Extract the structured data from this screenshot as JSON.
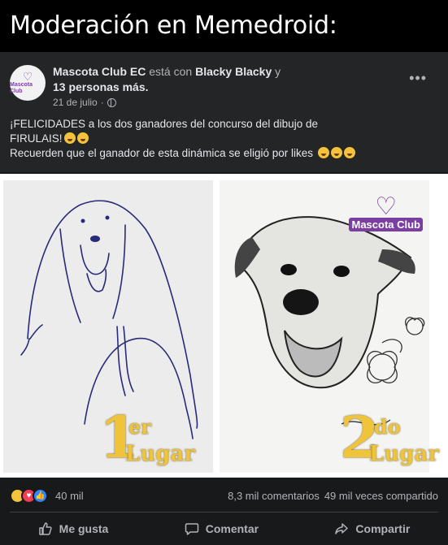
{
  "meme_title": "Moderación en Memedroid:",
  "post": {
    "page_name": "Mascota Club EC",
    "with_text": "está con",
    "tagged": "Blacky Blacky",
    "and_text": "y",
    "others": "13 personas más.",
    "date": "21 de julio",
    "dot": "·",
    "avatar_logo_text": "Mascota Club",
    "more_label": "•••",
    "line1": "¡FELICIDADES a los dos ganadores del concurso del dibujo de",
    "line2": "FIRULAIS!",
    "line3": "Recuerden que el ganador de esta dinámica se eligió por likes",
    "first_place_num": "1",
    "first_place_sup": "er",
    "first_place_word": "Lugar",
    "second_place_num": "2",
    "second_place_sup": "do",
    "second_place_word": "Lugar",
    "watermark": "Mascota Club"
  },
  "stats": {
    "reactions_count": "40 mil",
    "comments": "8,3 mil comentarios",
    "shares": "49 mil veces compartido"
  },
  "actions": {
    "like": "Me gusta",
    "comment": "Comentar",
    "share": "Compartir"
  },
  "colors": {
    "post_bg": "#242526",
    "feed_bg": "#18191a",
    "gold": "#f0c43a",
    "brand_purple": "#7a3fa0"
  }
}
